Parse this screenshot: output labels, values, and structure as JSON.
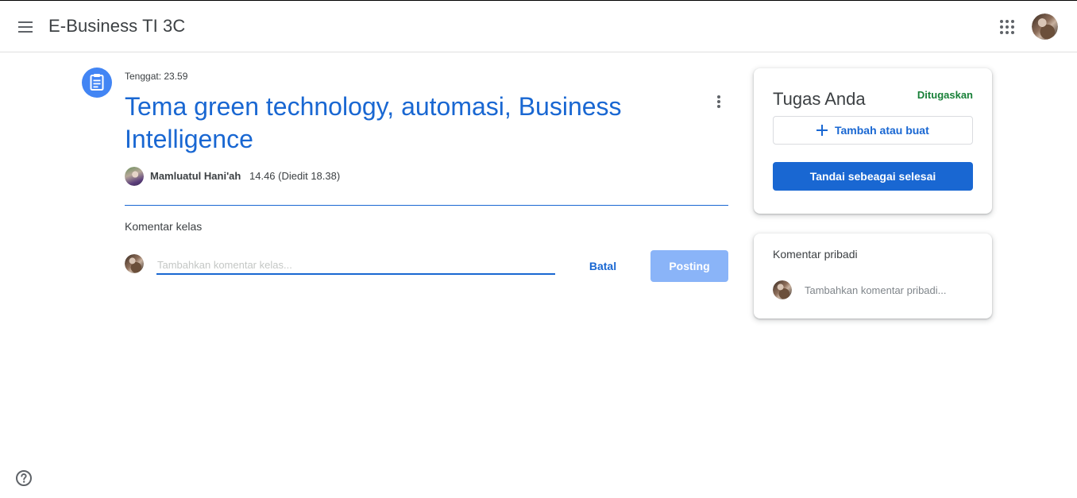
{
  "header": {
    "class_title": "E-Business TI 3C",
    "menu_icon": "menu-icon",
    "apps_icon": "apps-grid-icon"
  },
  "assignment": {
    "icon": "assignment-icon",
    "deadline": "Tenggat: 23.59",
    "title": "Tema green technology, automasi, Business Intelligence",
    "author": "Mamluatul Hani'ah",
    "posted": "14.46 (Diedit 18.38)"
  },
  "class_comments": {
    "heading": "Komentar kelas",
    "placeholder": "Tambahkan komentar kelas...",
    "cancel_label": "Batal",
    "post_label": "Posting"
  },
  "your_work": {
    "title": "Tugas Anda",
    "status": "Ditugaskan",
    "add_label": "Tambah atau buat",
    "mark_done_label": "Tandai sebeagai selesai"
  },
  "private_comments": {
    "heading": "Komentar pribadi",
    "placeholder": "Tambahkan komentar pribadi..."
  },
  "colors": {
    "primary": "#1967d2",
    "assigned_status": "#188038",
    "disabled_button": "#8ab4f8",
    "assignment_icon_bg": "#4285f4"
  }
}
